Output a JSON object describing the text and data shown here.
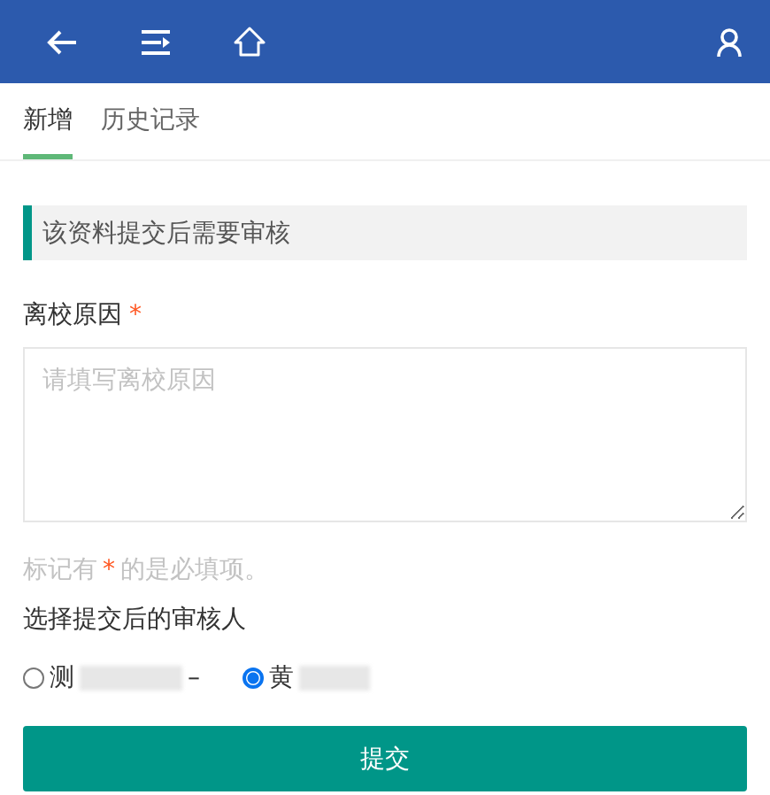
{
  "header": {
    "icons": [
      {
        "kind": "back"
      },
      {
        "kind": "menu"
      },
      {
        "kind": "home"
      },
      {
        "kind": "user"
      }
    ]
  },
  "tabs": [
    {
      "label": "新增",
      "selected": true
    },
    {
      "label": "历史记录",
      "selected": false
    }
  ],
  "notice": "该资料提交后需要审核",
  "field": {
    "label": "离校原因",
    "required_mark": "*",
    "placeholder": "请填写离校原因"
  },
  "hint": {
    "before": "标记有",
    "mark": "*",
    "after": "的是必填项。"
  },
  "reviewer": {
    "label": "选择提交后的审核人",
    "options": [
      {
        "label": "测",
        "suffix": "–",
        "selected": false
      },
      {
        "label": "黄",
        "selected": true
      }
    ]
  },
  "submit": "提交"
}
